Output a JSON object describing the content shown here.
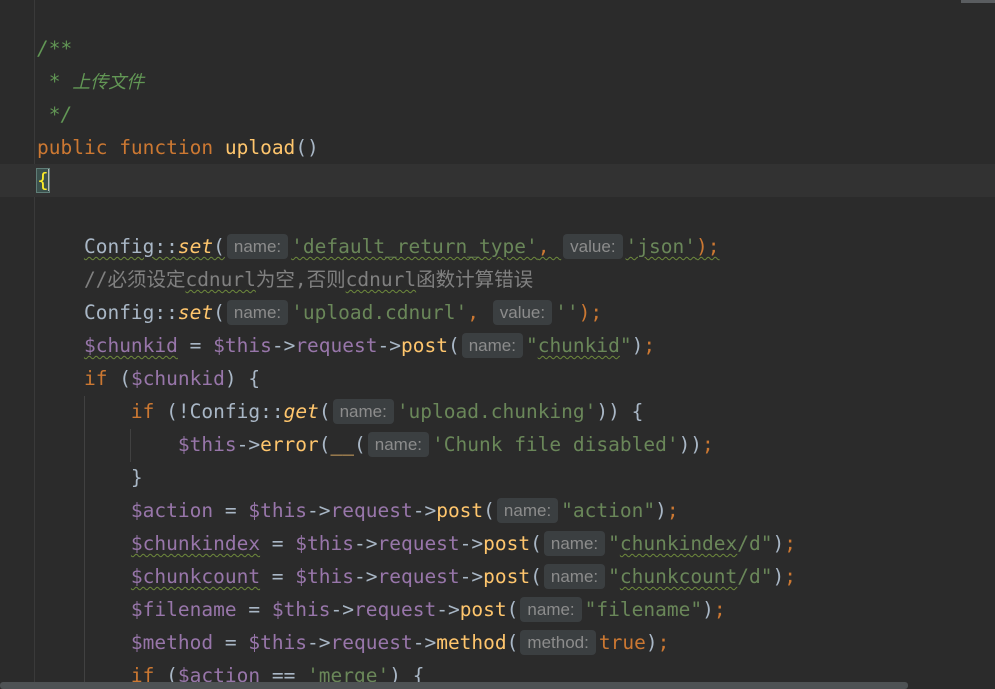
{
  "editor": {
    "lines": [
      [
        {
          "t": "/**",
          "c": "comment"
        }
      ],
      [
        {
          "t": " * ",
          "c": "comment"
        },
        {
          "t": "上传文件",
          "c": "comment cjk"
        }
      ],
      [
        {
          "t": " */",
          "c": "comment"
        }
      ],
      [
        {
          "t": "public ",
          "c": "kw"
        },
        {
          "t": "function ",
          "c": "kw"
        },
        {
          "t": "upload",
          "c": "fn"
        },
        {
          "t": "()",
          "c": "op"
        }
      ],
      [
        {
          "t": "{",
          "c": "brace-hl"
        },
        {
          "caret": true
        }
      ],
      [],
      [
        {
          "t": "    "
        },
        {
          "t": "Config",
          "c": "cls squig"
        },
        {
          "t": "::",
          "c": "op squig"
        },
        {
          "t": "set",
          "c": "static squig"
        },
        {
          "t": "(",
          "c": "op squig"
        },
        {
          "hint": "name:"
        },
        {
          "t": "'default_return_type'",
          "c": "str squig"
        },
        {
          "t": ", ",
          "c": "semi squig"
        },
        {
          "hint": "value:"
        },
        {
          "t": "'json'",
          "c": "str squig"
        },
        {
          "t": ");",
          "c": "semi squig"
        }
      ],
      [
        {
          "t": "    "
        },
        {
          "t": "//必须设定",
          "c": "comment-line"
        },
        {
          "t": "cdnurl",
          "c": "comment-line squig"
        },
        {
          "t": "为空,否则",
          "c": "comment-line"
        },
        {
          "t": "cdnurl",
          "c": "comment-line squig"
        },
        {
          "t": "函数计算错误",
          "c": "comment-line"
        }
      ],
      [
        {
          "t": "    "
        },
        {
          "t": "Config",
          "c": "cls"
        },
        {
          "t": "::",
          "c": "op"
        },
        {
          "t": "set",
          "c": "static"
        },
        {
          "t": "(",
          "c": "op"
        },
        {
          "hint": "name:"
        },
        {
          "t": "'upload.cdnurl'",
          "c": "str"
        },
        {
          "t": ", ",
          "c": "semi"
        },
        {
          "hint": "value:"
        },
        {
          "t": "''",
          "c": "str"
        },
        {
          "t": ");",
          "c": "semi"
        }
      ],
      [
        {
          "t": "    "
        },
        {
          "t": "$chunkid",
          "c": "var squig"
        },
        {
          "t": " = ",
          "c": "op"
        },
        {
          "t": "$this",
          "c": "var"
        },
        {
          "t": "->",
          "c": "op"
        },
        {
          "t": "request",
          "c": "var"
        },
        {
          "t": "->",
          "c": "op"
        },
        {
          "t": "post",
          "c": "fn"
        },
        {
          "t": "(",
          "c": "op"
        },
        {
          "hint": "name:"
        },
        {
          "t": "\"",
          "c": "str"
        },
        {
          "t": "chunkid",
          "c": "str squig"
        },
        {
          "t": "\"",
          "c": "str"
        },
        {
          "t": ")",
          "c": "op"
        },
        {
          "t": ";",
          "c": "semi"
        }
      ],
      [
        {
          "t": "    "
        },
        {
          "t": "if ",
          "c": "kw"
        },
        {
          "t": "(",
          "c": "op"
        },
        {
          "t": "$chunkid",
          "c": "var"
        },
        {
          "t": ") {",
          "c": "op"
        }
      ],
      [
        {
          "t": "        "
        },
        {
          "t": "if ",
          "c": "kw"
        },
        {
          "t": "(!",
          "c": "op"
        },
        {
          "t": "Config",
          "c": "cls"
        },
        {
          "t": "::",
          "c": "op"
        },
        {
          "t": "get",
          "c": "static"
        },
        {
          "t": "(",
          "c": "op"
        },
        {
          "hint": "name:"
        },
        {
          "t": "'upload.chunking'",
          "c": "str"
        },
        {
          "t": ")) {",
          "c": "op"
        }
      ],
      [
        {
          "t": "            "
        },
        {
          "t": "$this",
          "c": "var"
        },
        {
          "t": "->",
          "c": "op"
        },
        {
          "t": "error",
          "c": "fn"
        },
        {
          "t": "(",
          "c": "op"
        },
        {
          "t": "__",
          "c": "fn"
        },
        {
          "t": "(",
          "c": "op"
        },
        {
          "hint": "name:"
        },
        {
          "t": "'Chunk file disabled'",
          "c": "str"
        },
        {
          "t": "))",
          "c": "op"
        },
        {
          "t": ";",
          "c": "semi"
        }
      ],
      [
        {
          "t": "        "
        },
        {
          "t": "}",
          "c": "op"
        }
      ],
      [
        {
          "t": "        "
        },
        {
          "t": "$action",
          "c": "var"
        },
        {
          "t": " = ",
          "c": "op"
        },
        {
          "t": "$this",
          "c": "var"
        },
        {
          "t": "->",
          "c": "op"
        },
        {
          "t": "request",
          "c": "var"
        },
        {
          "t": "->",
          "c": "op"
        },
        {
          "t": "post",
          "c": "fn"
        },
        {
          "t": "(",
          "c": "op"
        },
        {
          "hint": "name:"
        },
        {
          "t": "\"action\"",
          "c": "str"
        },
        {
          "t": ")",
          "c": "op"
        },
        {
          "t": ";",
          "c": "semi"
        }
      ],
      [
        {
          "t": "        "
        },
        {
          "t": "$chunkindex",
          "c": "var squig"
        },
        {
          "t": " = ",
          "c": "op"
        },
        {
          "t": "$this",
          "c": "var"
        },
        {
          "t": "->",
          "c": "op"
        },
        {
          "t": "request",
          "c": "var"
        },
        {
          "t": "->",
          "c": "op"
        },
        {
          "t": "post",
          "c": "fn"
        },
        {
          "t": "(",
          "c": "op"
        },
        {
          "hint": "name:"
        },
        {
          "t": "\"",
          "c": "str"
        },
        {
          "t": "chunkindex",
          "c": "str squig"
        },
        {
          "t": "/d\"",
          "c": "str"
        },
        {
          "t": ")",
          "c": "op"
        },
        {
          "t": ";",
          "c": "semi"
        }
      ],
      [
        {
          "t": "        "
        },
        {
          "t": "$chunkcount",
          "c": "var squig"
        },
        {
          "t": " = ",
          "c": "op"
        },
        {
          "t": "$this",
          "c": "var"
        },
        {
          "t": "->",
          "c": "op"
        },
        {
          "t": "request",
          "c": "var"
        },
        {
          "t": "->",
          "c": "op"
        },
        {
          "t": "post",
          "c": "fn"
        },
        {
          "t": "(",
          "c": "op"
        },
        {
          "hint": "name:"
        },
        {
          "t": "\"",
          "c": "str"
        },
        {
          "t": "chunkcount",
          "c": "str squig"
        },
        {
          "t": "/d\"",
          "c": "str"
        },
        {
          "t": ")",
          "c": "op"
        },
        {
          "t": ";",
          "c": "semi"
        }
      ],
      [
        {
          "t": "        "
        },
        {
          "t": "$filename",
          "c": "var"
        },
        {
          "t": " = ",
          "c": "op"
        },
        {
          "t": "$this",
          "c": "var"
        },
        {
          "t": "->",
          "c": "op"
        },
        {
          "t": "request",
          "c": "var"
        },
        {
          "t": "->",
          "c": "op"
        },
        {
          "t": "post",
          "c": "fn"
        },
        {
          "t": "(",
          "c": "op"
        },
        {
          "hint": "name:"
        },
        {
          "t": "\"filename\"",
          "c": "str"
        },
        {
          "t": ")",
          "c": "op"
        },
        {
          "t": ";",
          "c": "semi"
        }
      ],
      [
        {
          "t": "        "
        },
        {
          "t": "$method",
          "c": "var"
        },
        {
          "t": " = ",
          "c": "op"
        },
        {
          "t": "$this",
          "c": "var"
        },
        {
          "t": "->",
          "c": "op"
        },
        {
          "t": "request",
          "c": "var"
        },
        {
          "t": "->",
          "c": "op"
        },
        {
          "t": "method",
          "c": "fn"
        },
        {
          "t": "(",
          "c": "op"
        },
        {
          "hint": "method:"
        },
        {
          "t": "true",
          "c": "kw"
        },
        {
          "t": ")",
          "c": "op"
        },
        {
          "t": ";",
          "c": "semi"
        }
      ],
      [
        {
          "t": "        "
        },
        {
          "t": "if ",
          "c": "kw"
        },
        {
          "t": "(",
          "c": "op"
        },
        {
          "t": "$action",
          "c": "var"
        },
        {
          "t": " == ",
          "c": "op"
        },
        {
          "t": "'merge'",
          "c": "str"
        },
        {
          "t": ") {",
          "c": "op"
        }
      ]
    ]
  }
}
